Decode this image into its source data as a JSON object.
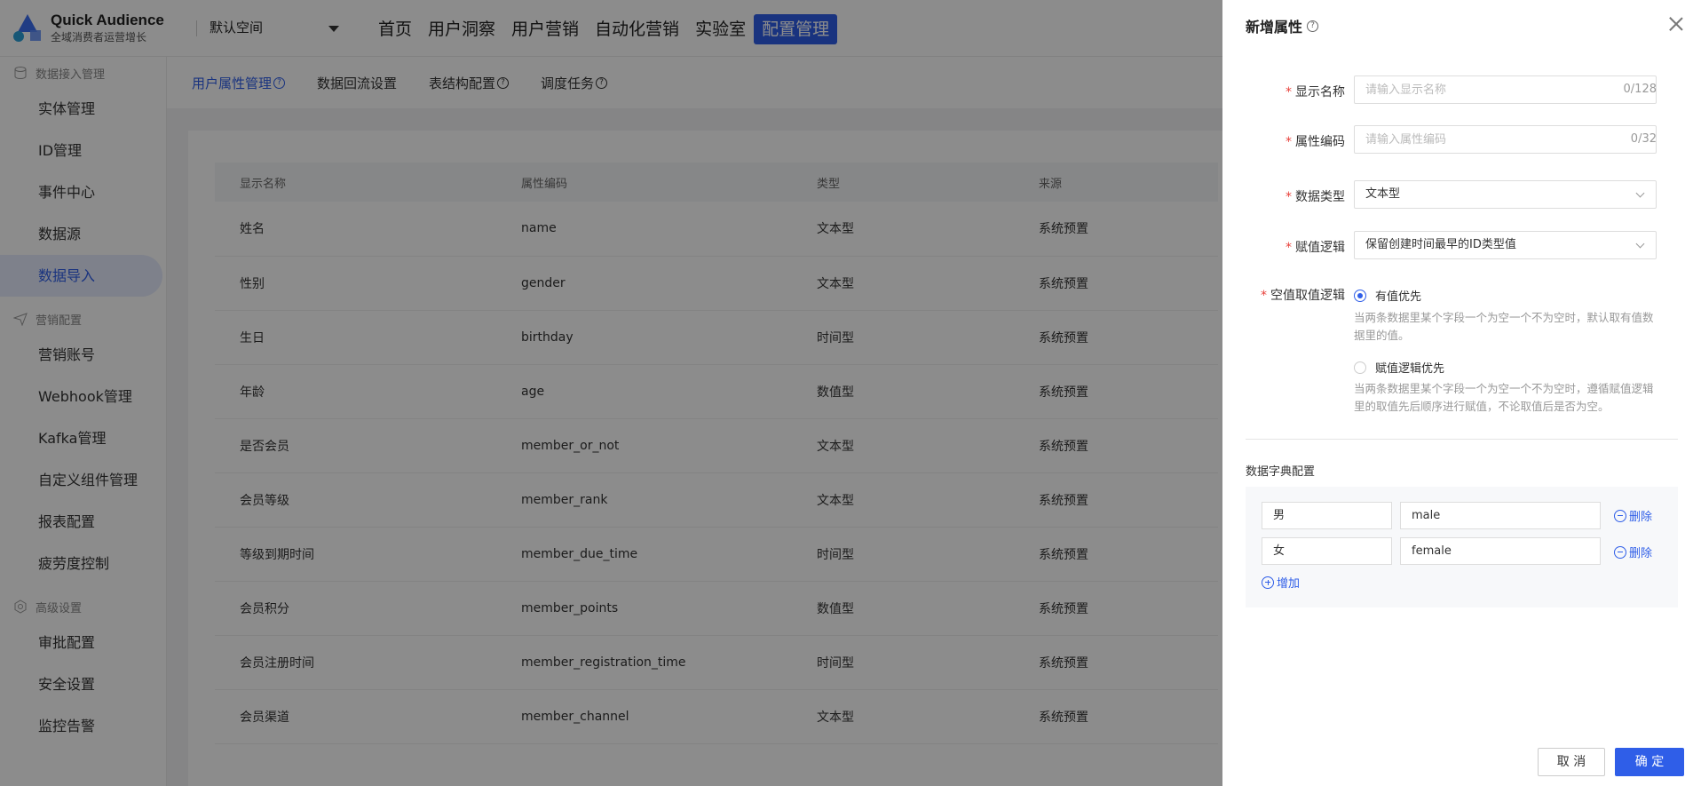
{
  "header": {
    "brand_name": "Quick Audience",
    "brand_sub": "全域消费者运营增长",
    "workspace": "默认空间",
    "nav": [
      "首页",
      "用户洞察",
      "用户营销",
      "自动化营销",
      "实验室",
      "配置管理"
    ],
    "active_nav": "配置管理",
    "accent_color": "#2f5ee8"
  },
  "sidebar": {
    "groups": [
      {
        "title": "数据接入管理",
        "icon": "database-icon",
        "items": [
          "实体管理",
          "ID管理",
          "事件中心",
          "数据源",
          "数据导入"
        ]
      },
      {
        "title": "营销配置",
        "icon": "send-icon",
        "items": [
          "营销账号",
          "Webhook管理",
          "Kafka管理",
          "自定义组件管理",
          "报表配置",
          "疲劳度控制"
        ]
      },
      {
        "title": "高级设置",
        "icon": "gear-icon",
        "items": [
          "审批配置",
          "安全设置",
          "监控告警"
        ]
      }
    ],
    "active_item": "数据导入"
  },
  "subtabs": [
    "用户属性管理",
    "数据回流设置",
    "表结构配置",
    "调度任务"
  ],
  "table": {
    "columns": [
      "显示名称",
      "属性编码",
      "类型",
      "来源"
    ],
    "rows": [
      [
        "姓名",
        "name",
        "文本型",
        "系统预置"
      ],
      [
        "性别",
        "gender",
        "文本型",
        "系统预置"
      ],
      [
        "生日",
        "birthday",
        "时间型",
        "系统预置"
      ],
      [
        "年龄",
        "age",
        "数值型",
        "系统预置"
      ],
      [
        "是否会员",
        "member_or_not",
        "文本型",
        "系统预置"
      ],
      [
        "会员等级",
        "member_rank",
        "文本型",
        "系统预置"
      ],
      [
        "等级到期时间",
        "member_due_time",
        "时间型",
        "系统预置"
      ],
      [
        "会员积分",
        "member_points",
        "数值型",
        "系统预置"
      ],
      [
        "会员注册时间",
        "member_registration_time",
        "时间型",
        "系统预置"
      ],
      [
        "会员渠道",
        "member_channel",
        "文本型",
        "系统预置"
      ]
    ]
  },
  "drawer": {
    "title": "新增属性",
    "display_name": {
      "label": "显示名称",
      "placeholder": "请输入显示名称",
      "value": "",
      "count": "0/128"
    },
    "attr_code": {
      "label": "属性编码",
      "placeholder": "请输入属性编码",
      "value": "",
      "count": "0/32"
    },
    "data_type": {
      "label": "数据类型",
      "value": "文本型"
    },
    "assign_logic": {
      "label": "赋值逻辑",
      "value": "保留创建时间最早的ID类型值"
    },
    "null_logic": {
      "label": "空值取值逻辑",
      "options": [
        {
          "label": "有值优先",
          "help_line1": "当两条数据里某个字段一个为空一个不为空时，默认取有值数",
          "help_line2": "据里的值。",
          "selected": true
        },
        {
          "label": "赋值逻辑优先",
          "help_line1": "当两条数据里某个字段一个为空一个不为空时，遵循赋值逻辑",
          "help_line2": "里的取值先后顺序进行赋值，不论取值后是否为空。",
          "selected": false
        }
      ]
    },
    "dict_title": "数据字典配置",
    "dict_rows": [
      {
        "key": "男",
        "value": "male"
      },
      {
        "key": "女",
        "value": "female"
      }
    ],
    "delete_label": "删除",
    "add_label": "增加",
    "cancel_label": "取 消",
    "ok_label": "确 定"
  }
}
